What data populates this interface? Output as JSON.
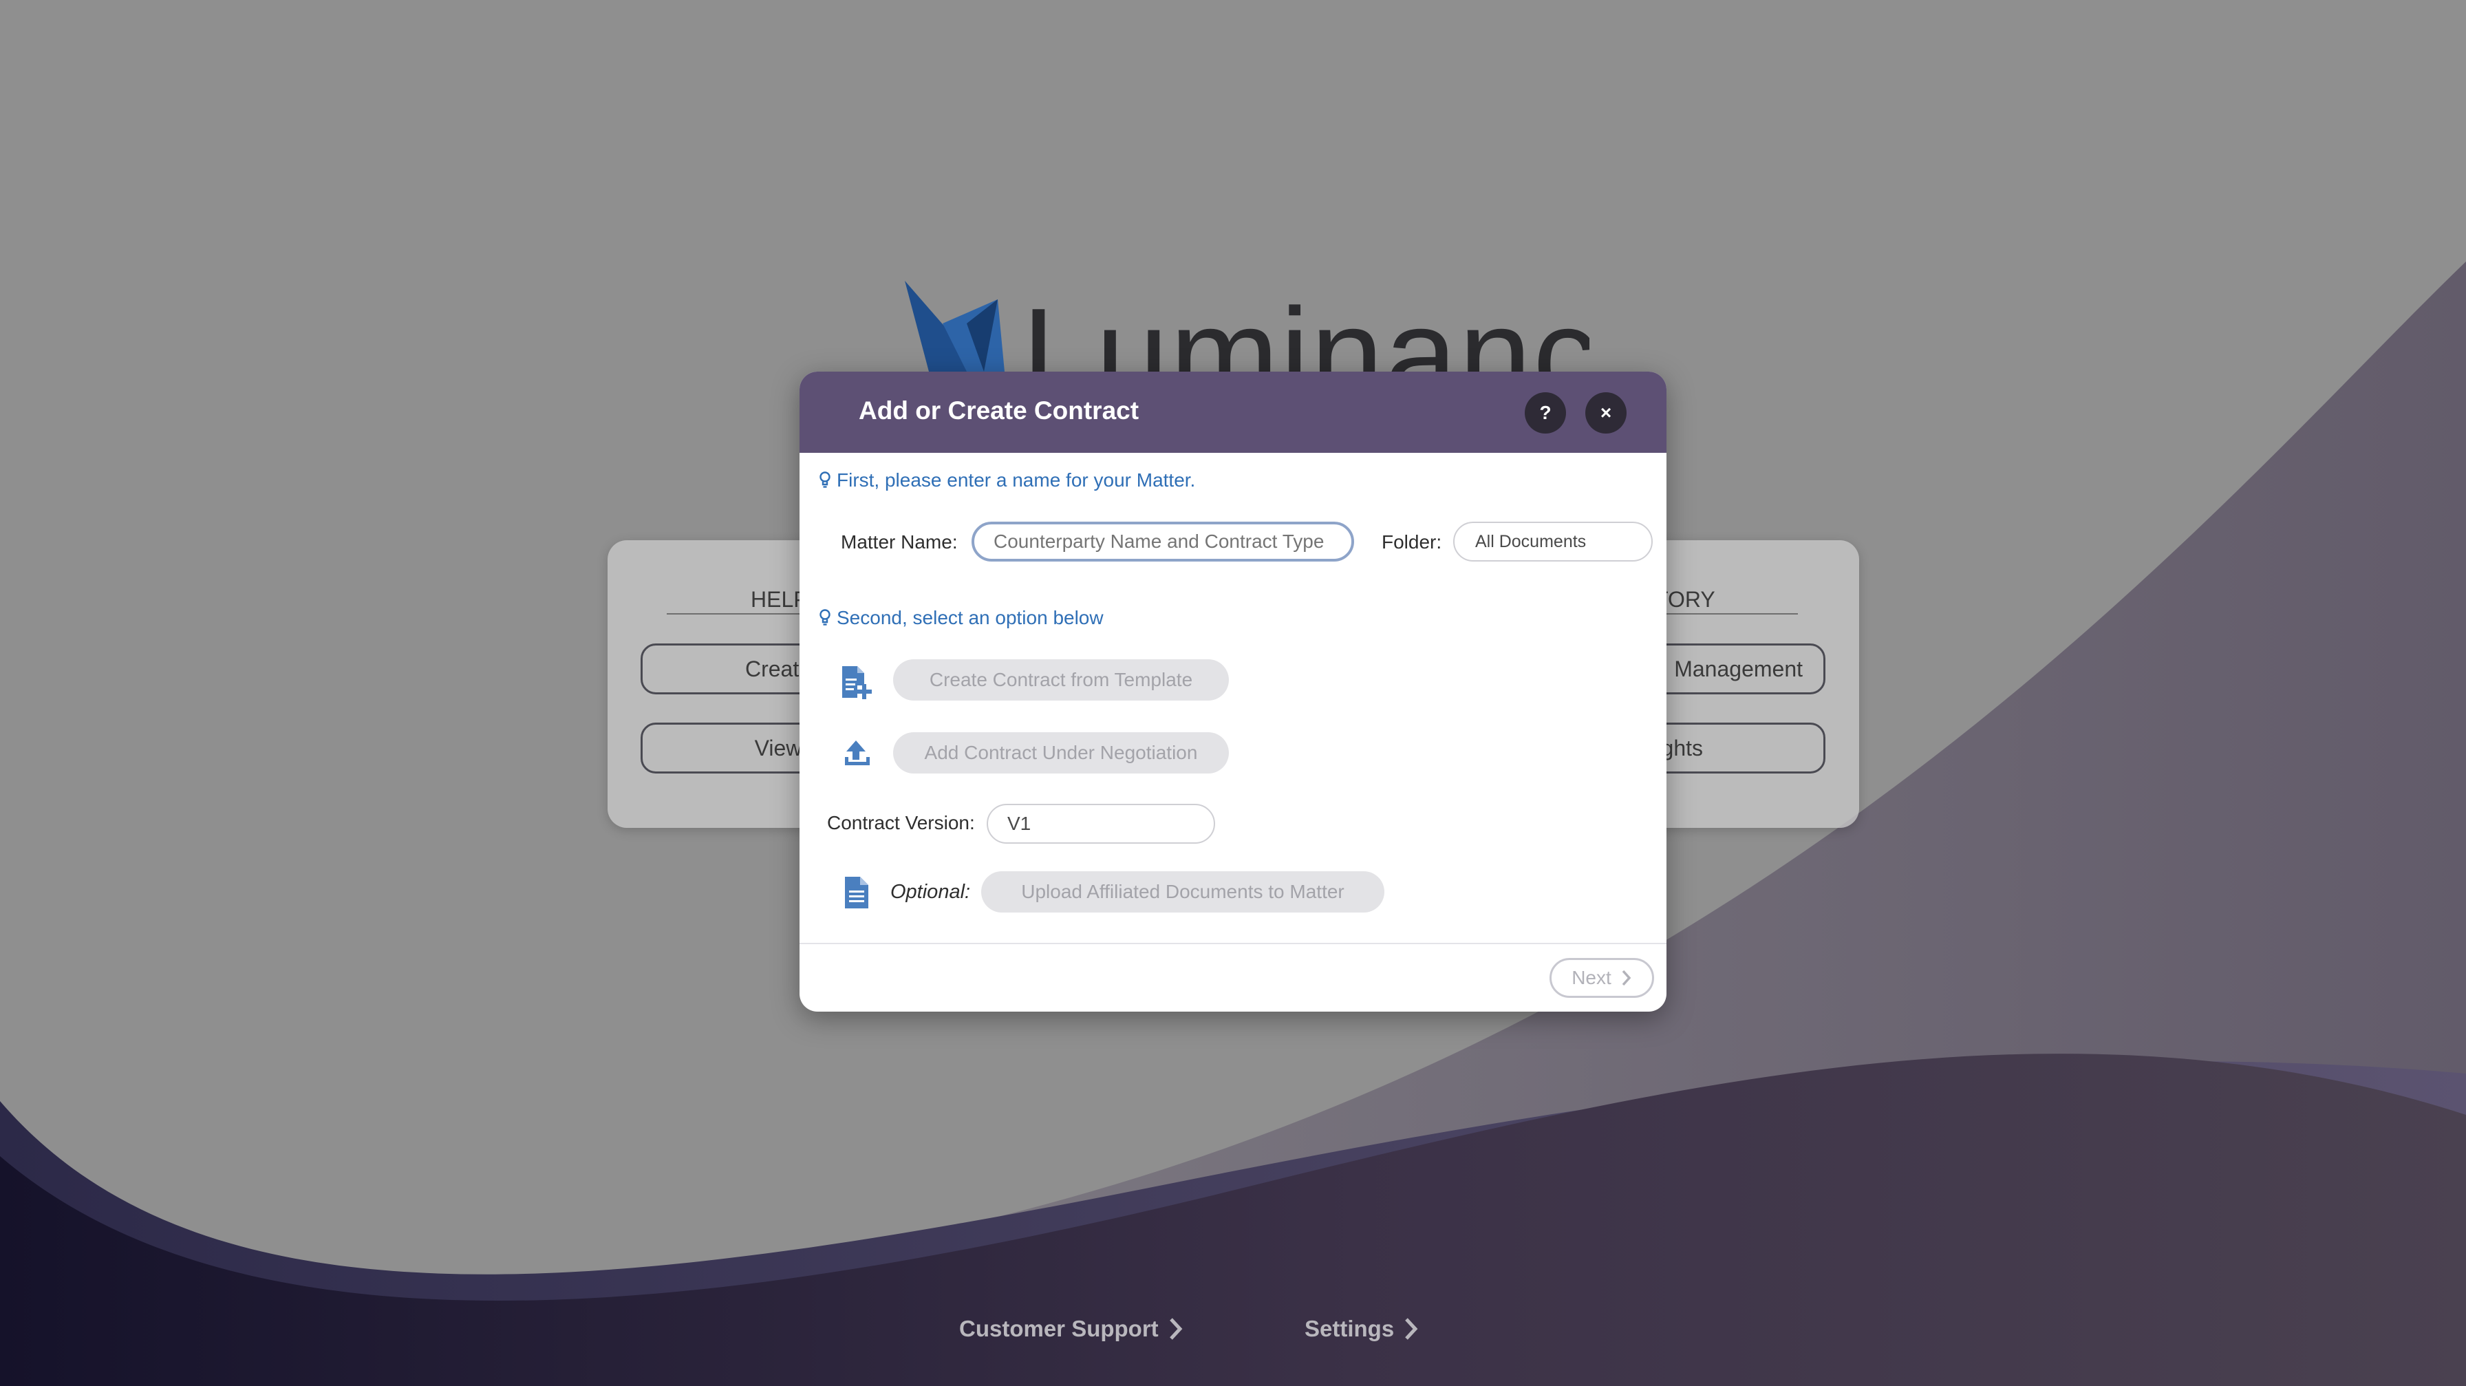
{
  "app": {
    "logo_text": "Luminance"
  },
  "home": {
    "left_column_title": "HELP",
    "right_column_title": "TORY",
    "left_buttons": [
      "Create",
      "View"
    ],
    "right_buttons": [
      "Management",
      "sights"
    ]
  },
  "footer": {
    "customer_support": "Customer Support",
    "settings": "Settings"
  },
  "modal": {
    "title": "Add or Create Contract",
    "help_label": "?",
    "close_label": "×",
    "hint_first": "First, please enter a name for your Matter.",
    "matter_name_label": "Matter Name:",
    "matter_name_placeholder": "Counterparty Name and Contract Type",
    "folder_label": "Folder:",
    "folder_value": "All Documents",
    "hint_second": "Second, select an option below",
    "option_template": "Create Contract from Template",
    "option_negotiation": "Add Contract Under Negotiation",
    "contract_version_label": "Contract Version:",
    "contract_version_value": "V1",
    "optional_label": "Optional:",
    "option_affiliated": "Upload Affiliated Documents to Matter",
    "next_label": "Next"
  },
  "colors": {
    "header": "#5d5074",
    "accent_blue": "#2f6fb6",
    "icon_blue": "#4a7fbf",
    "background": "#8f8f8f",
    "wave_dark": "#2a2238"
  }
}
